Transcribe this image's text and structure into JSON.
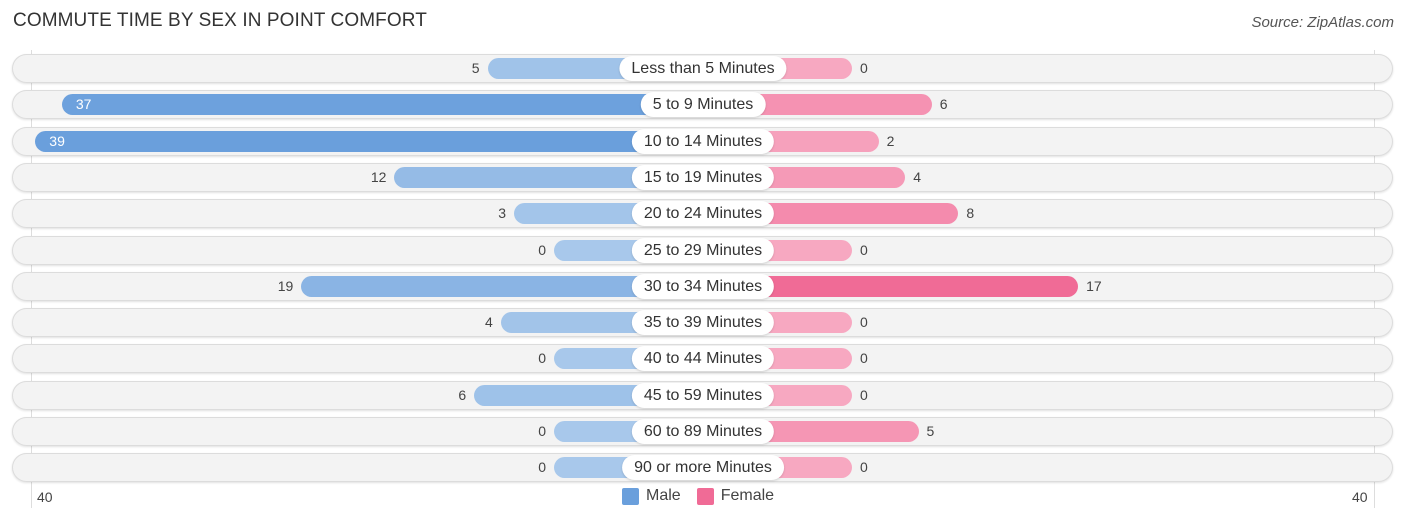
{
  "title": "COMMUTE TIME BY SEX IN POINT COMFORT",
  "source": "Source: ZipAtlas.com",
  "colors": {
    "male": "#6a9fdc",
    "male_light": "#a8c8eb",
    "female": "#f06b96",
    "female_light": "#f7a8c1"
  },
  "chart_data": {
    "type": "bar",
    "orientation": "horizontal-diverging",
    "title": "COMMUTE TIME BY SEX IN POINT COMFORT",
    "categories": [
      "Less than 5 Minutes",
      "5 to 9 Minutes",
      "10 to 14 Minutes",
      "15 to 19 Minutes",
      "20 to 24 Minutes",
      "25 to 29 Minutes",
      "30 to 34 Minutes",
      "35 to 39 Minutes",
      "40 to 44 Minutes",
      "45 to 59 Minutes",
      "60 to 89 Minutes",
      "90 or more Minutes"
    ],
    "series": [
      {
        "name": "Male",
        "values": [
          5,
          37,
          39,
          12,
          3,
          0,
          19,
          4,
          0,
          6,
          0,
          0
        ]
      },
      {
        "name": "Female",
        "values": [
          0,
          6,
          2,
          4,
          8,
          0,
          17,
          0,
          0,
          0,
          5,
          0
        ]
      }
    ],
    "axis": {
      "left_label": "40",
      "right_label": "40",
      "range": [
        0,
        40
      ]
    },
    "legend": {
      "position": "bottom-center",
      "entries": [
        "Male",
        "Female"
      ]
    }
  }
}
